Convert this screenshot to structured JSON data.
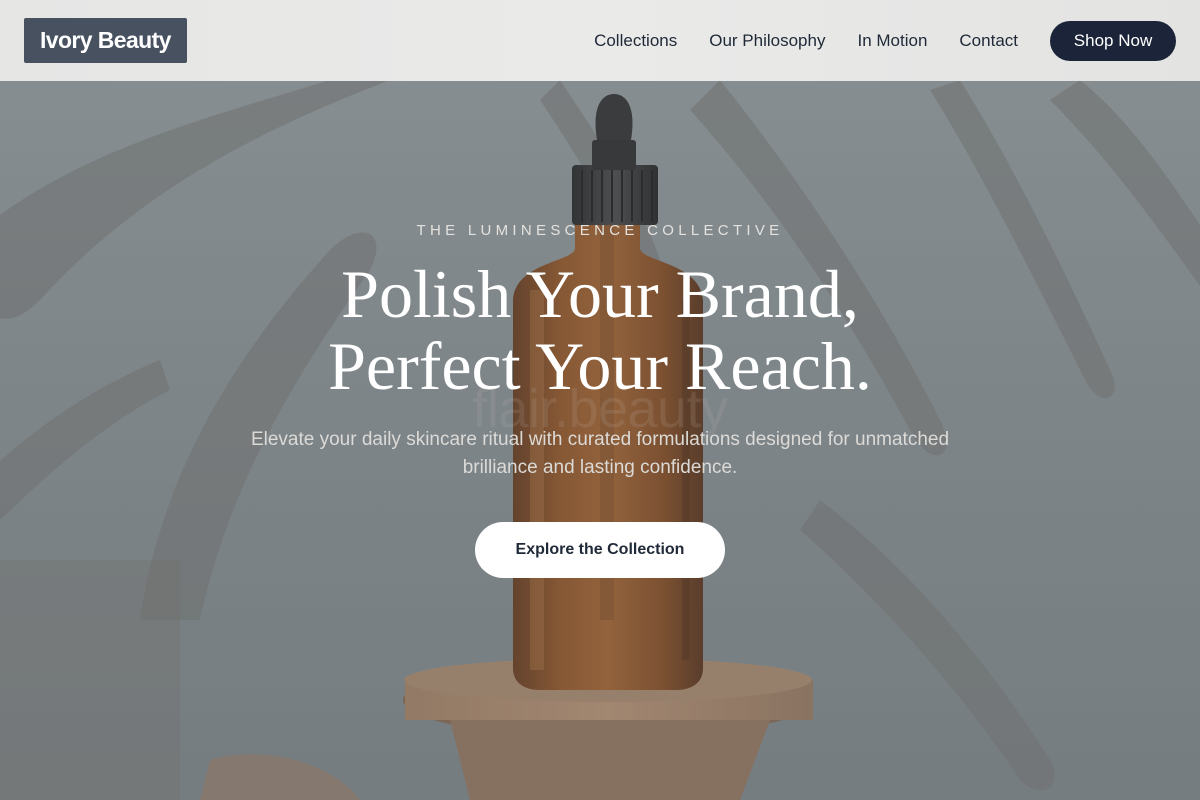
{
  "nav": {
    "logo": "Ivory Beauty",
    "links": [
      "Collections",
      "Our Philosophy",
      "In Motion",
      "Contact"
    ],
    "cta": "Shop Now"
  },
  "hero": {
    "eyebrow": "THE LUMINESCENCE COLLECTIVE",
    "headline_line1": "Polish Your Brand,",
    "headline_line2": "Perfect Your Reach.",
    "bottle_print": "flair.beauty",
    "subtext": "Elevate your daily skincare ritual with curated formulations designed for unmatched brilliance and lasting confidence.",
    "button": "Explore the Collection",
    "background_subject": "amber dropper bottle on wooden pedestal with leaf shadows"
  },
  "colors": {
    "nav_bg": "#e8e8e7",
    "logo_bg": "#475160",
    "shop_button": "#1b2438",
    "hero_overlay": "#7c8387",
    "bottle_amber": "#7a3d12"
  }
}
